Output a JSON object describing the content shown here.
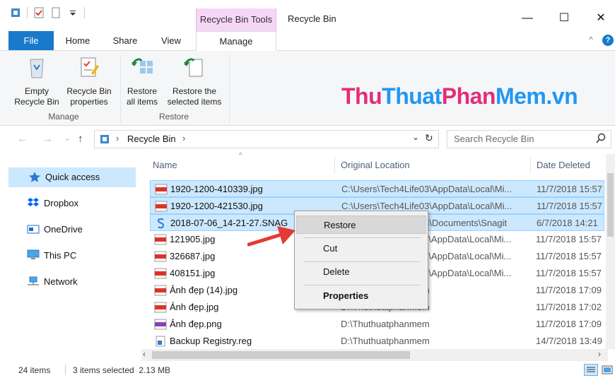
{
  "window": {
    "title": "Recycle Bin",
    "context_tab_header": "Recycle Bin Tools",
    "minimize_glyph": "—",
    "maximize_glyph": "☐",
    "close_glyph": "✕"
  },
  "tabs": {
    "file": "File",
    "home": "Home",
    "share": "Share",
    "view": "View",
    "manage": "Manage"
  },
  "ribbon": {
    "empty_bin": "Empty\nRecycle Bin",
    "bin_props": "Recycle Bin\nproperties",
    "restore_all": "Restore\nall items",
    "restore_sel": "Restore the\nselected items",
    "group_manage": "Manage",
    "group_restore": "Restore",
    "collapse_glyph": "^",
    "help_glyph": "?"
  },
  "watermark": {
    "p1": "Thu",
    "p2": "Thuat",
    "p3": "Phan",
    "p4": "Mem.vn"
  },
  "nav": {
    "back": "←",
    "forward": "→",
    "recent": "⌄",
    "up": "↑",
    "address_location": "Recycle Bin",
    "address_chevron": "›",
    "address_dropdown": "⌄",
    "refresh": "↻",
    "search_placeholder": "Search Recycle Bin"
  },
  "navpane": {
    "quick_access": "Quick access",
    "dropbox": "Dropbox",
    "onedrive": "OneDrive",
    "this_pc": "This PC",
    "network": "Network"
  },
  "columns": {
    "name": "Name",
    "location": "Original Location",
    "date": "Date Deleted"
  },
  "files": [
    {
      "name": "1920-1200-410339.jpg",
      "location": "C:\\Users\\Tech4Life03\\AppData\\Local\\Mi...",
      "date": "11/7/2018 15:57",
      "type": "jpg",
      "selected": true
    },
    {
      "name": "1920-1200-421530.jpg",
      "location": "C:\\Users\\Tech4Life03\\AppData\\Local\\Mi...",
      "date": "11/7/2018 15:57",
      "type": "jpg",
      "selected": true
    },
    {
      "name": "2018-07-06_14-21-27.SNAG",
      "location": "C:\\Users\\Tech4Life03\\Documents\\Snagit",
      "date": "6/7/2018 14:21",
      "type": "snag",
      "selected": true
    },
    {
      "name": "121905.jpg",
      "location": "C:\\Users\\Tech4Life03\\AppData\\Local\\Mi...",
      "date": "11/7/2018 15:57",
      "type": "jpg",
      "selected": false
    },
    {
      "name": "326687.jpg",
      "location": "C:\\Users\\Tech4Life03\\AppData\\Local\\Mi...",
      "date": "11/7/2018 15:57",
      "type": "jpg",
      "selected": false
    },
    {
      "name": "408151.jpg",
      "location": "C:\\Users\\Tech4Life03\\AppData\\Local\\Mi...",
      "date": "11/7/2018 15:57",
      "type": "jpg",
      "selected": false
    },
    {
      "name": "Ảnh đẹp (14).jpg",
      "location": "D:\\Thuthuatphanmem",
      "date": "11/7/2018 17:09",
      "type": "jpg",
      "selected": false
    },
    {
      "name": "Ảnh đẹp.jpg",
      "location": "D:\\Thuthuatphanmem",
      "date": "11/7/2018 17:02",
      "type": "jpg",
      "selected": false
    },
    {
      "name": "Ảnh đẹp.png",
      "location": "D:\\Thuthuatphanmem",
      "date": "11/7/2018 17:09",
      "type": "png",
      "selected": false
    },
    {
      "name": "Backup Registry.reg",
      "location": "D:\\Thuthuatphanmem",
      "date": "14/7/2018 13:49",
      "type": "reg",
      "selected": false
    }
  ],
  "context_menu": {
    "restore": "Restore",
    "cut": "Cut",
    "delete": "Delete",
    "properties": "Properties"
  },
  "status": {
    "items": "24 items",
    "selected": "3 items selected  2.13 MB"
  },
  "colors": {
    "accent": "#1979ca",
    "context_tab": "#f6d6f6",
    "selection": "#cce8ff",
    "watermark_pink": "#e32d79",
    "watermark_blue": "#2196f3",
    "arrow_red": "#e53935"
  }
}
